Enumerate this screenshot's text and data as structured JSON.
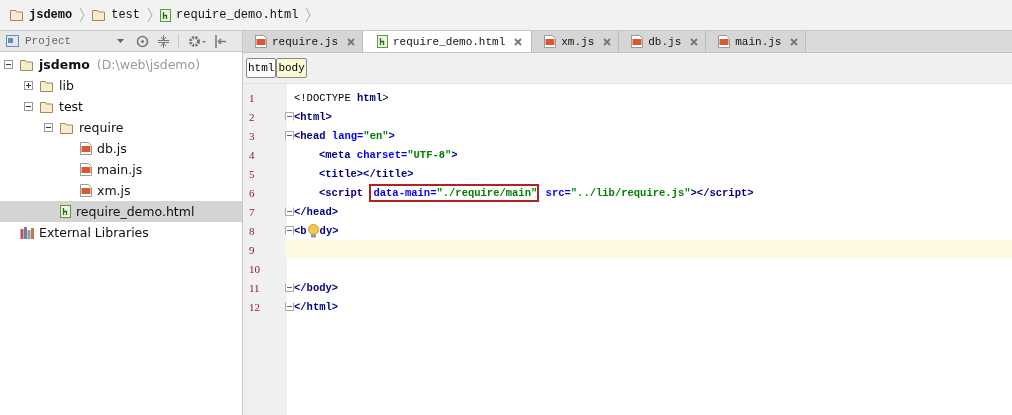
{
  "breadcrumb": [
    {
      "kind": "folder",
      "label": "jsdemo",
      "bold": true
    },
    {
      "kind": "folder",
      "label": "test",
      "bold": false
    },
    {
      "kind": "html",
      "label": "require_demo.html",
      "bold": false
    }
  ],
  "project_panel": {
    "title": "Project",
    "tree": [
      {
        "kind": "folder",
        "label": "jsdemo",
        "location": "(D:\\web\\jsdemo)",
        "expanded": true,
        "selected": false,
        "children": [
          {
            "kind": "folder",
            "label": "lib",
            "expanded": false,
            "selected": false
          },
          {
            "kind": "folder",
            "label": "test",
            "expanded": true,
            "selected": false,
            "children": [
              {
                "kind": "folder",
                "label": "require",
                "expanded": true,
                "selected": false,
                "children": [
                  {
                    "kind": "js",
                    "label": "db.js",
                    "selected": false
                  },
                  {
                    "kind": "js",
                    "label": "main.js",
                    "selected": false
                  },
                  {
                    "kind": "js",
                    "label": "xm.js",
                    "selected": false
                  }
                ]
              },
              {
                "kind": "html",
                "label": "require_demo.html",
                "selected": true
              }
            ]
          }
        ]
      },
      {
        "kind": "library",
        "label": "External Libraries",
        "selected": false
      }
    ]
  },
  "tabs": [
    {
      "kind": "js",
      "label": "require.js",
      "selected": false
    },
    {
      "kind": "html",
      "label": "require_demo.html",
      "selected": true
    },
    {
      "kind": "js",
      "label": "xm.js",
      "selected": false
    },
    {
      "kind": "js",
      "label": "db.js",
      "selected": false
    },
    {
      "kind": "js",
      "label": "main.js",
      "selected": false
    }
  ],
  "tag_path": [
    {
      "label": "html",
      "selected": false
    },
    {
      "label": "body",
      "selected": true
    }
  ],
  "editor": {
    "lines": [
      {
        "number": "1",
        "current": false,
        "segments": [
          {
            "text": "<!DOCTYPE html>",
            "boxed": false
          }
        ]
      },
      {
        "number": "2",
        "current": false,
        "fold_open": true,
        "segments": [
          {
            "text": "<html>",
            "boxed": false
          }
        ]
      },
      {
        "number": "3",
        "current": false,
        "fold_open": true,
        "segments": [
          {
            "text": "<head lang=\"en\">",
            "boxed": false
          }
        ]
      },
      {
        "number": "4",
        "current": false,
        "indent": true,
        "segments": [
          {
            "text": "<meta charset=\"UTF-8\">",
            "boxed": false
          }
        ]
      },
      {
        "number": "5",
        "current": false,
        "indent": true,
        "segments": [
          {
            "text": "<title></title>",
            "boxed": false
          }
        ]
      },
      {
        "number": "6",
        "current": false,
        "indent": true,
        "segments": [
          {
            "text": "<script ",
            "boxed": false
          },
          {
            "text": "data-main=\"./require/main\"",
            "boxed": true
          },
          {
            "text": " src=\"../lib/require.js\"></script>",
            "boxed": false
          }
        ]
      },
      {
        "number": "7",
        "current": false,
        "fold_close": true,
        "segments": [
          {
            "text": "</head>",
            "boxed": false
          }
        ]
      },
      {
        "number": "8",
        "current": false,
        "fold_open": true,
        "bulb": true,
        "segments": [
          {
            "text": "<b",
            "boxed": false
          },
          {
            "text": "dy>",
            "boxed": false
          }
        ]
      },
      {
        "number": "9",
        "current": true
      },
      {
        "number": "10",
        "current": false
      },
      {
        "number": "11",
        "current": false,
        "fold_close": true,
        "segments": [
          {
            "text": "</body>",
            "boxed": false
          }
        ]
      },
      {
        "number": "12",
        "current": false,
        "fold_close": true,
        "segments": [
          {
            "text": "</html>",
            "boxed": false
          }
        ]
      }
    ]
  }
}
